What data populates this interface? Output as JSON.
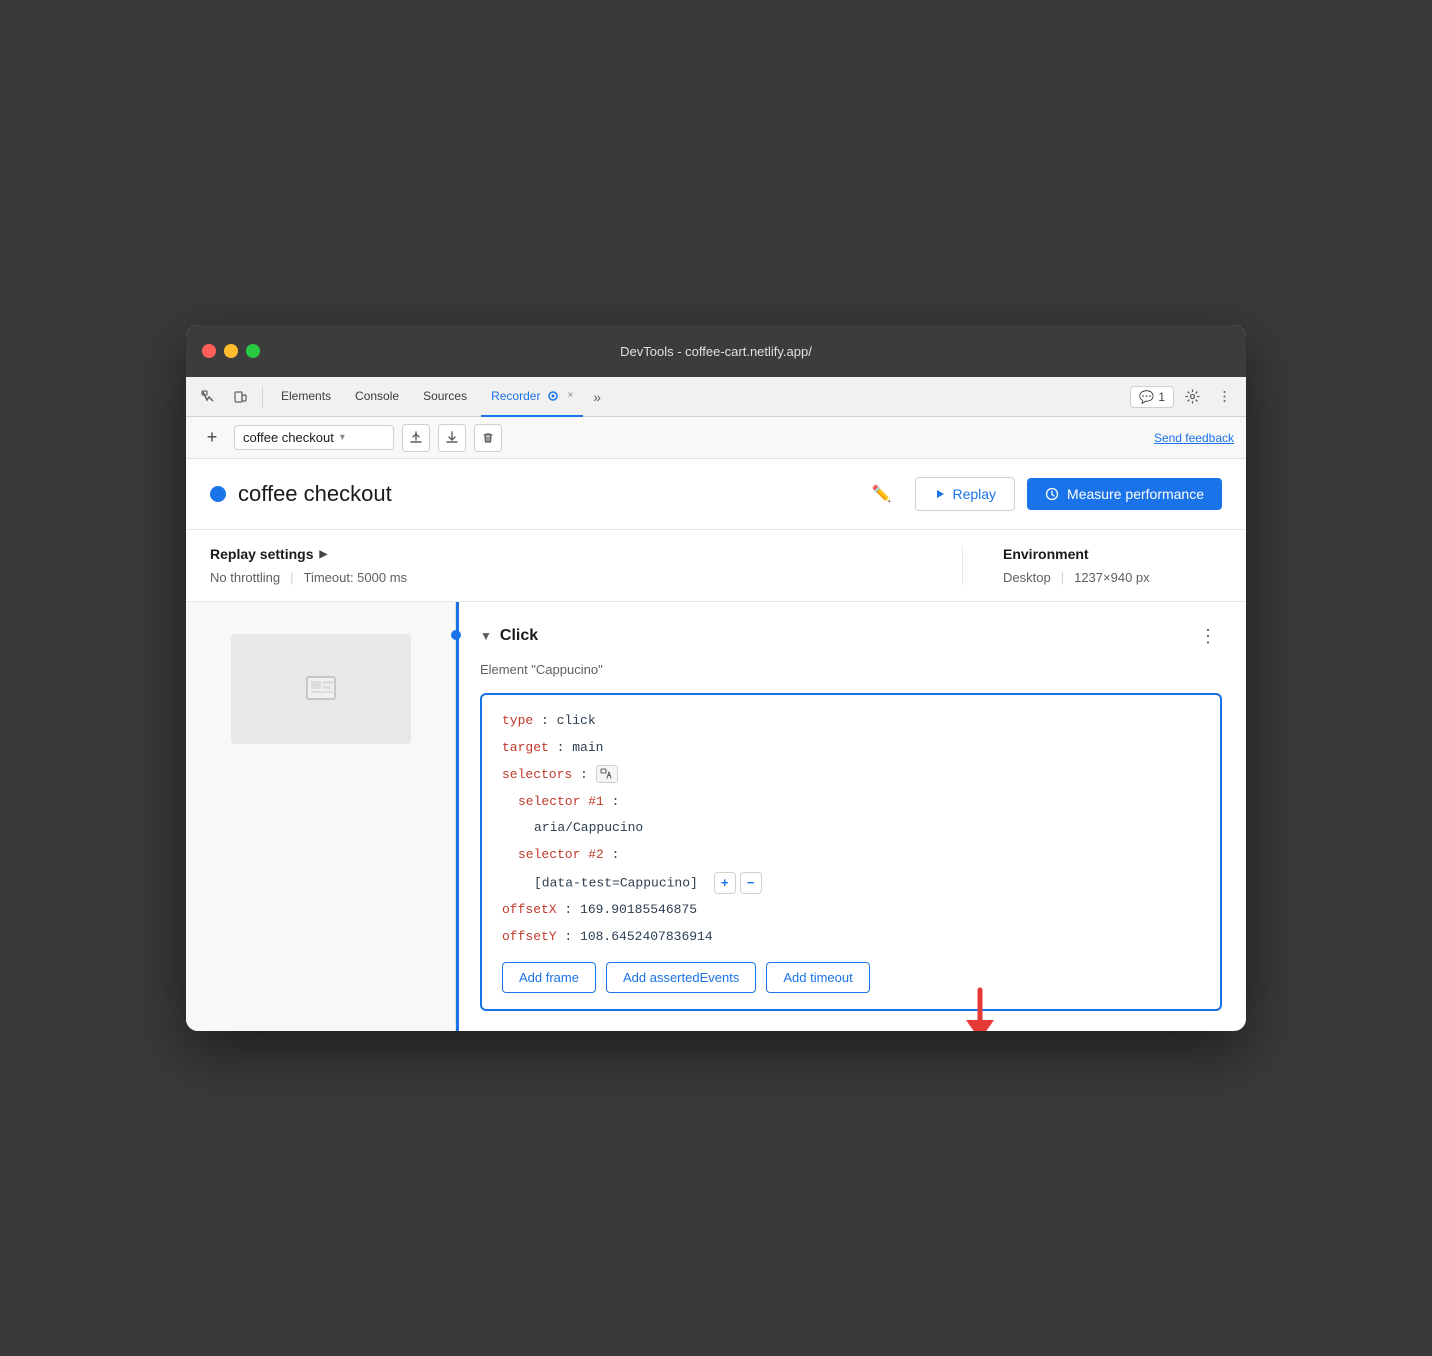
{
  "window": {
    "title": "DevTools - coffee-cart.netlify.app/"
  },
  "traffic_lights": {
    "red_label": "close",
    "yellow_label": "minimize",
    "green_label": "maximize"
  },
  "tabs": [
    {
      "label": "Elements",
      "active": false
    },
    {
      "label": "Console",
      "active": false
    },
    {
      "label": "Sources",
      "active": false
    },
    {
      "label": "Recorder",
      "active": true
    },
    {
      "label": "×",
      "active": false
    }
  ],
  "tabs_more": "»",
  "badge": {
    "icon": "💬",
    "count": "1"
  },
  "toolbar": {
    "add_label": "+",
    "recording_name": "coffee checkout",
    "export_label": "↑",
    "import_label": "↓",
    "delete_label": "🗑",
    "send_feedback": "Send feedback"
  },
  "recording": {
    "title": "coffee checkout",
    "edit_icon": "✏️",
    "replay_label": "Replay",
    "measure_label": "Measure performance"
  },
  "replay_settings": {
    "heading": "Replay settings",
    "arrow": "▶",
    "throttling": "No throttling",
    "timeout": "Timeout: 5000 ms"
  },
  "environment": {
    "heading": "Environment",
    "viewport": "Desktop",
    "resolution": "1237×940 px"
  },
  "step": {
    "expand_icon": "▼",
    "type": "Click",
    "element": "Element \"Cappucino\"",
    "menu_icon": "⋮",
    "code": {
      "type_key": "type",
      "type_val": "click",
      "target_key": "target",
      "target_val": "main",
      "selectors_key": "selectors",
      "selector_icon": "⌖",
      "selector1_key": "selector #1",
      "selector1_val": "aria/Cappucino",
      "selector2_key": "selector #2",
      "selector2_val": "[data-test=Cappucino]",
      "offsetX_key": "offsetX",
      "offsetX_val": "169.90185546875",
      "offsetY_key": "offsetY",
      "offsetY_val": "108.6452407836914"
    },
    "add_frame": "Add frame",
    "add_asserted_events": "Add assertedEvents",
    "add_timeout": "Add timeout"
  }
}
